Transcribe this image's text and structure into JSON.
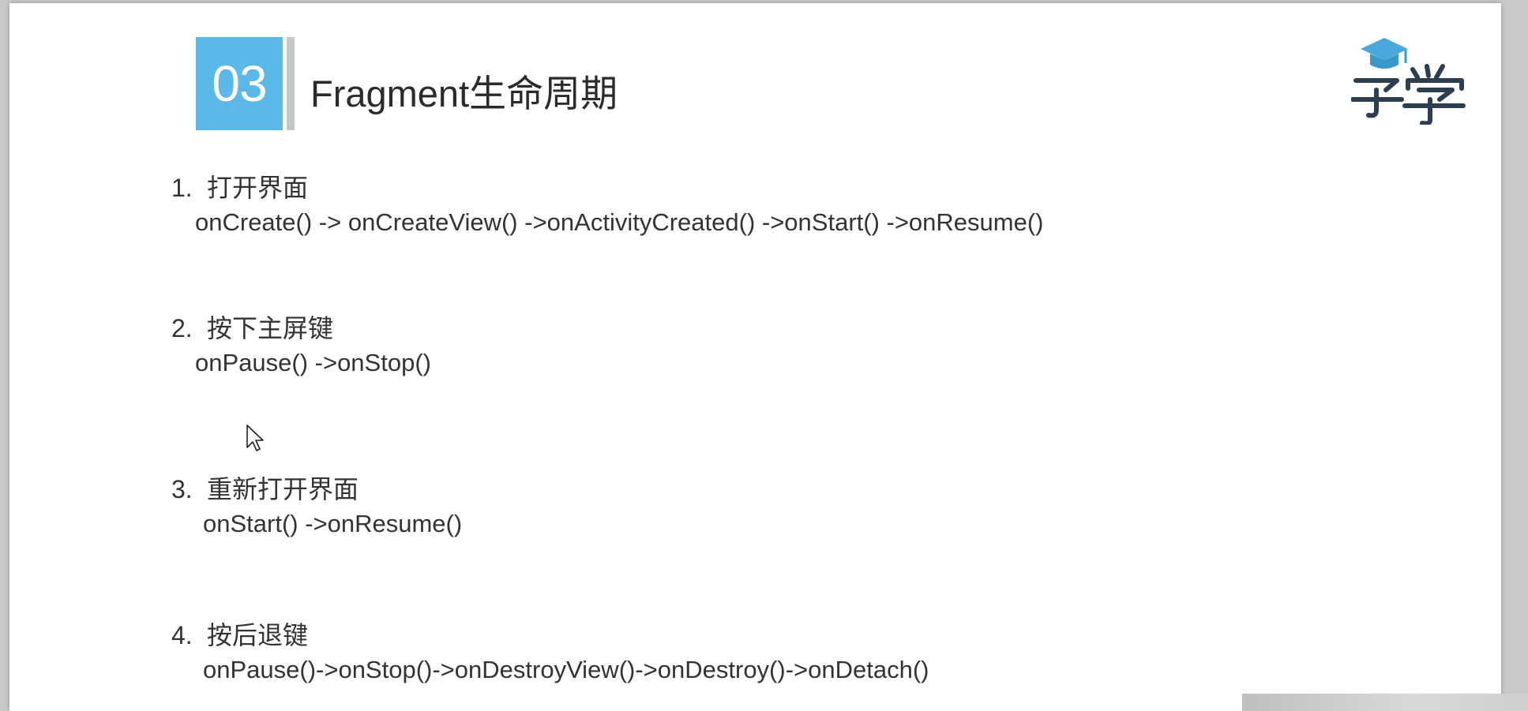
{
  "section": {
    "number": "03",
    "title": "Fragment生命周期"
  },
  "colors": {
    "accent": "#5bb8e9",
    "bar": "#c6c6c6",
    "text": "#333333"
  },
  "logo": {
    "name": "graduation-cap-xuexue-logo"
  },
  "items": [
    {
      "number": "1.",
      "heading": "打开界面",
      "calls": "onCreate() -> onCreateView() ->onActivityCreated() ->onStart() ->onResume()"
    },
    {
      "number": "2.",
      "heading": "按下主屏键",
      "calls": "onPause() ->onStop()"
    },
    {
      "number": "3.",
      "heading": "重新打开界面",
      "calls": "onStart() ->onResume()"
    },
    {
      "number": "4.",
      "heading": "按后退键",
      "calls": "onPause()->onStop()->onDestroyView()->onDestroy()->onDetach()"
    }
  ]
}
